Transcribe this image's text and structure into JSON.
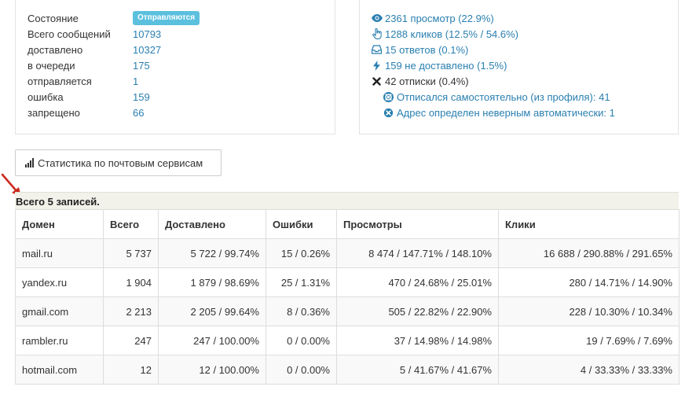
{
  "status": {
    "rows": [
      {
        "label": "Состояние",
        "badge": "Отправляются"
      },
      {
        "label": "Всего сообщений",
        "value": "10793"
      },
      {
        "label": "доставлено",
        "value": "10327"
      },
      {
        "label": "в очереди",
        "value": "175"
      },
      {
        "label": "отправляется",
        "value": "1"
      },
      {
        "label": "ошибка",
        "value": "159"
      },
      {
        "label": "запрещено",
        "value": "66"
      }
    ]
  },
  "events": {
    "views": "2361 просмотр (22.9%)",
    "clicks": "1288 кликов (12.5% / 54.6%)",
    "replies": "15 ответов (0.1%)",
    "undelivered": "159 не доставлено (1.5%)",
    "unsubscribes": "42 отписки (0.4%)",
    "unsub_self": "Отписался самостоятельно (из профиля): 41",
    "unsub_auto": "Адрес определен неверным автоматически: 1"
  },
  "toolbar": {
    "mail_stats_label": "Статистика по почтовым сервисам"
  },
  "table": {
    "summary": "Всего 5 записей.",
    "headers": [
      "Домен",
      "Всего",
      "Доставлено",
      "Ошибки",
      "Просмотры",
      "Клики"
    ],
    "rows": [
      [
        "mail.ru",
        "5 737",
        "5 722 / 99.74%",
        "15 / 0.26%",
        "8 474 / 147.71% / 148.10%",
        "16 688 / 290.88% / 291.65%"
      ],
      [
        "yandex.ru",
        "1 904",
        "1 879 / 98.69%",
        "25 / 1.31%",
        "470 / 24.68% / 25.01%",
        "280 / 14.71% / 14.90%"
      ],
      [
        "gmail.com",
        "2 213",
        "2 205 / 99.64%",
        "8 / 0.36%",
        "505 / 22.82% / 22.90%",
        "228 / 10.30% / 10.34%"
      ],
      [
        "rambler.ru",
        "247",
        "247 / 100.00%",
        "0 / 0.00%",
        "37 / 14.98% / 14.98%",
        "19 / 7.69% / 7.69%"
      ],
      [
        "hotmail.com",
        "12",
        "12 / 100.00%",
        "0 / 0.00%",
        "5 / 41.67% / 41.67%",
        "4 / 33.33% / 33.33%"
      ]
    ]
  },
  "colors": {
    "link": "#2a7fb0",
    "badge": "#5bc0de",
    "annotation_arrow": "#cc2a1f"
  }
}
